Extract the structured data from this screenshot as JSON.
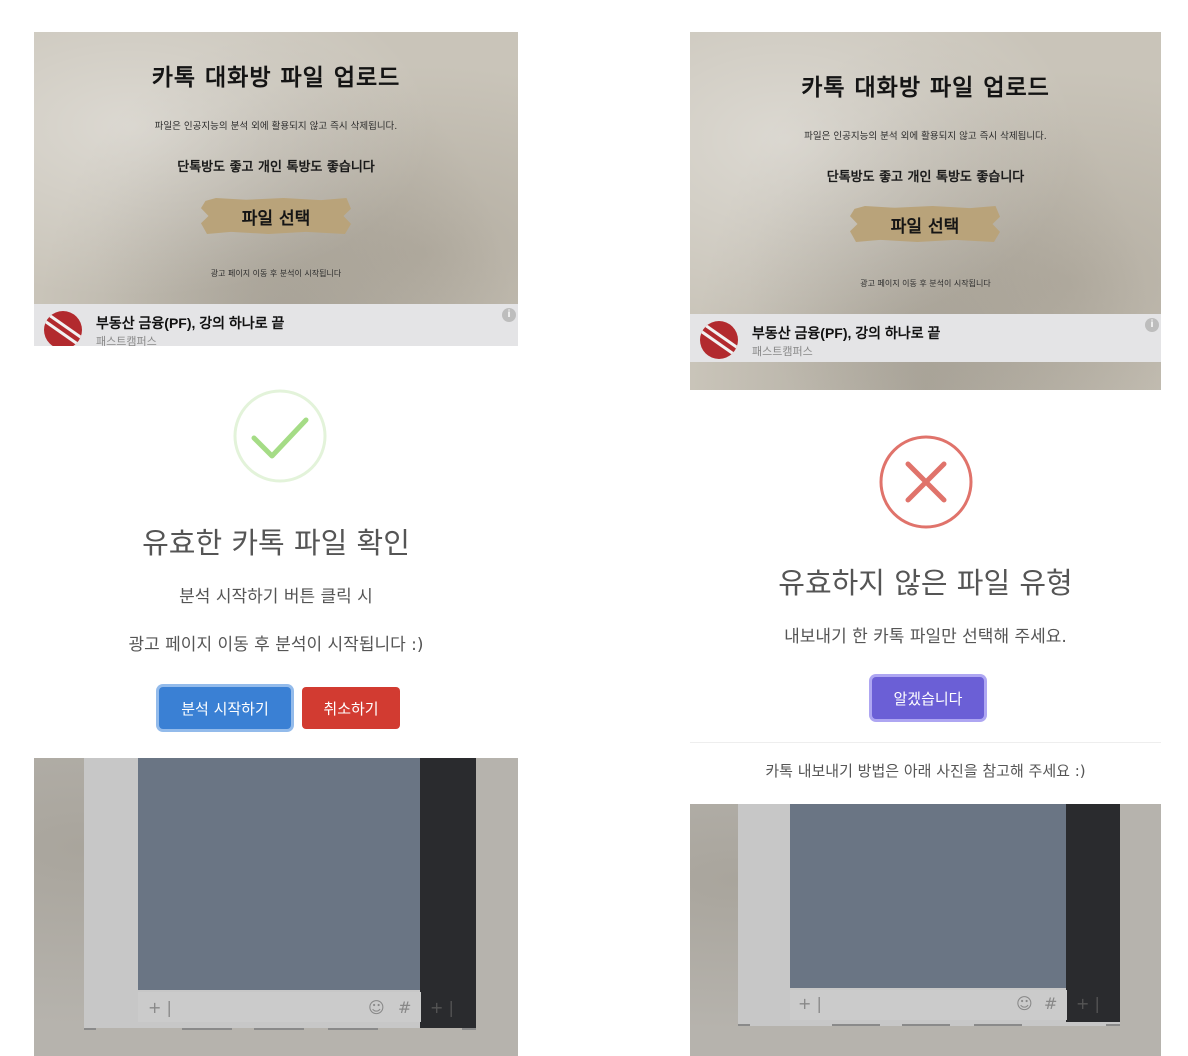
{
  "left": {
    "hero": {
      "title": "카톡 대화방 파일 업로드",
      "desc": "파일은 인공지능의 분석 외에 활용되지 않고 즉시 삭제됩니다.",
      "sub": "단톡방도 좋고 개인 톡방도 좋습니다",
      "file_button": "파일 선택",
      "note": "광고 페이지 이동 후 분석이 시작됩니다"
    },
    "ad": {
      "title": "부동산 금융(PF), 강의 하나로 끝",
      "sponsor": "패스트캠퍼스",
      "info": "i"
    },
    "dialog": {
      "status": "success",
      "title": "유효한 카톡 파일 확인",
      "line1": "분석 시작하기 버튼 클릭 시",
      "line2": "광고 페이지 이동 후 분석이 시작됩니다 :)",
      "confirm_label": "분석 시작하기",
      "cancel_label": "취소하기"
    },
    "screenshot": {
      "plus_glyph": "+ |",
      "emoji_glyph": "☺",
      "hash_glyph": "#",
      "plus_glyph_dark": "+ |"
    }
  },
  "right": {
    "hero": {
      "title": "카톡 대화방 파일 업로드",
      "desc": "파일은 인공지능의 분석 외에 활용되지 않고 즉시 삭제됩니다.",
      "sub": "단톡방도 좋고 개인 톡방도 좋습니다",
      "file_button": "파일 선택",
      "note": "광고 페이지 이동 후 분석이 시작됩니다"
    },
    "ad": {
      "title": "부동산 금융(PF), 강의 하나로 끝",
      "sponsor": "패스트캠퍼스",
      "info": "i"
    },
    "dialog": {
      "status": "error",
      "title": "유효하지 않은 파일 유형",
      "line1": "내보내기 한 카톡 파일만 선택해 주세요.",
      "confirm_label": "알겠습니다",
      "footer": "카톡 내보내기 방법은 아래 사진을 참고해 주세요 :)"
    },
    "screenshot": {
      "plus_glyph": "+ |",
      "emoji_glyph": "☺",
      "hash_glyph": "#",
      "plus_glyph_dark": "+ |"
    }
  },
  "colors": {
    "success": "#a5dc86",
    "success_ring": "#e3f3da",
    "error": "#e0736b",
    "primary_button": "#3a80d4",
    "danger_button": "#d23b31",
    "confirm_button": "#6b5fd6",
    "paper": "#c9c4b9"
  }
}
